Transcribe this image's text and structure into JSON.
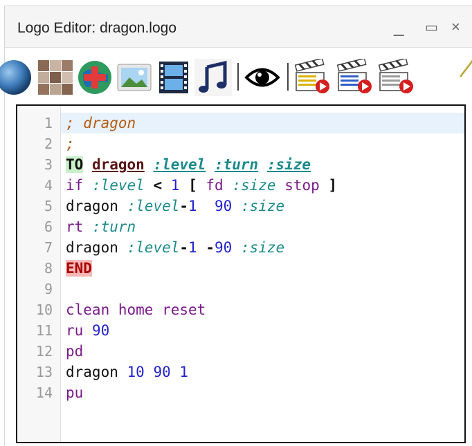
{
  "window": {
    "title": "Logo Editor: dragon.logo",
    "controls": {
      "minimize": "_",
      "maximize": "▭",
      "close": "×"
    }
  },
  "toolbar": {
    "buttons": [
      {
        "name": "sphere-icon"
      },
      {
        "name": "texture-icon"
      },
      {
        "name": "add-globe-icon"
      },
      {
        "name": "image-icon"
      },
      {
        "name": "film-icon"
      },
      {
        "name": "music-note-icon"
      },
      {
        "name": "eye-icon"
      },
      {
        "name": "clapper-play-icon"
      },
      {
        "name": "clapper-play-blue-icon"
      },
      {
        "name": "clapper-play-alt-icon"
      }
    ]
  },
  "editor": {
    "line_numbers": [
      "1",
      "2",
      "3",
      "4",
      "5",
      "6",
      "7",
      "8",
      "9",
      "10",
      "11",
      "12",
      "13",
      "14"
    ],
    "tokens": {
      "l1_comment": "; dragon",
      "l2_comment": ";",
      "l3_to": "TO",
      "l3_name": "dragon",
      "l3_p1": ":level",
      "l3_p2": ":turn",
      "l3_p3": ":size",
      "l4_if": "if",
      "l4_var": ":level",
      "l4_lt": "<",
      "l4_one": "1",
      "l4_lb": "[",
      "l4_fd": "fd",
      "l4_size": ":size",
      "l4_stop": "stop",
      "l4_rb": "]",
      "l5_dragon": "dragon",
      "l5_level": ":level",
      "l5_minus": "-",
      "l5_one": "1",
      "l5_ninety": "90",
      "l5_size": ":size",
      "l6_rt": "rt",
      "l6_turn": ":turn",
      "l7_dragon": "dragon",
      "l7_level": ":level",
      "l7_minus": "-",
      "l7_one": "1",
      "l7_neg": "-",
      "l7_ninety": "90",
      "l7_size": ":size",
      "l8_end": "END",
      "l10_clean": "clean",
      "l10_home": "home",
      "l10_reset": "reset",
      "l11_ru": "ru",
      "l11_ninety": "90",
      "l12_pd": "pd",
      "l13_dragon": "dragon",
      "l13_ten": "10",
      "l13_ninety": "90",
      "l13_one": "1",
      "l14_pu": "pu"
    }
  },
  "colors": {
    "active_line": "#e8f2fc",
    "comment": "#b35c14",
    "keyword_to_bg": "#c9f0c9",
    "keyword_end_bg": "#f6b8b8",
    "parameter": "#1a8a8a",
    "command": "#7a1a8a",
    "number": "#2222cc"
  }
}
